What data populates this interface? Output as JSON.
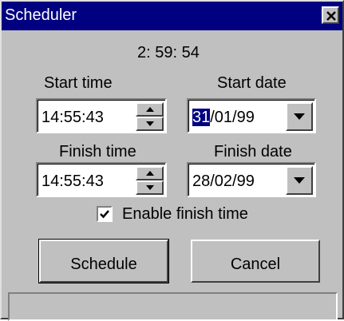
{
  "window": {
    "title": "Scheduler"
  },
  "timer": "2: 59: 54",
  "start": {
    "time_label": "Start time",
    "time_value": "14:55:43",
    "date_label": "Start date",
    "date_day": "31",
    "date_rest": "/01/99"
  },
  "finish": {
    "time_label": "Finish time",
    "time_value": "14:55:43",
    "date_label": "Finish date",
    "date_value": "28/02/99"
  },
  "enable_finish": {
    "label": "Enable finish time",
    "checked": true
  },
  "buttons": {
    "schedule": "Schedule",
    "cancel": "Cancel"
  },
  "status": {
    "text": ""
  },
  "icons": {
    "close": "close-icon",
    "spin_up": "spin-up-icon",
    "spin_down": "spin-down-icon",
    "dropdown": "dropdown-arrow-icon",
    "check": "checkmark-icon"
  },
  "colors": {
    "titlebar": "#000080",
    "face": "#c0c0c0",
    "selection": "#000080"
  }
}
